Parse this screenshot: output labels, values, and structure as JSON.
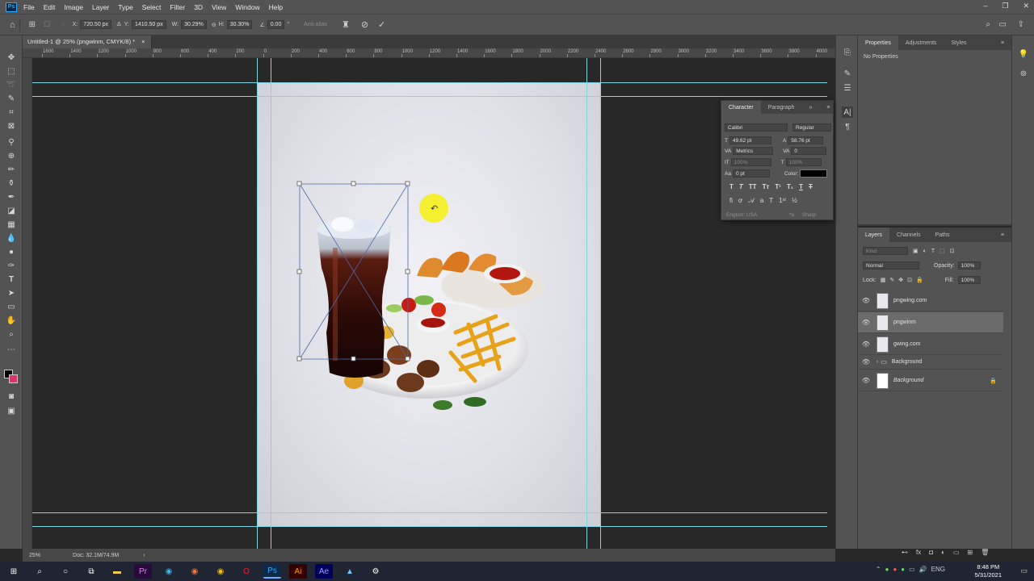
{
  "app": {
    "logo": "Ps"
  },
  "menu": [
    "File",
    "Edit",
    "Image",
    "Layer",
    "Type",
    "Select",
    "Filter",
    "3D",
    "View",
    "Window",
    "Help"
  ],
  "options": {
    "x_label": "X:",
    "x_value": "720.50 px",
    "y_label": "Y:",
    "y_value": "1410.50 px",
    "w_label": "W:",
    "w_value": "30.29%",
    "h_label": "H:",
    "h_value": "30.30%",
    "angle_value": "0.00",
    "angle_unit": "°",
    "antialias": "Anti-alias"
  },
  "doc_tab": {
    "title": "Untitled-1 @ 25% (pngwinm, CMYK/8) *",
    "close": "×"
  },
  "ruler": {
    "h_ticks": [
      "1600",
      "1400",
      "1200",
      "1000",
      "800",
      "600",
      "400",
      "200",
      "0",
      "200",
      "400",
      "600",
      "800",
      "1000",
      "1200",
      "1400",
      "1600",
      "1800",
      "2000",
      "2200",
      "2400",
      "2600",
      "2800",
      "3000",
      "3200",
      "3400",
      "3600",
      "3800",
      "4000",
      "4200"
    ]
  },
  "status": {
    "zoom": "25%",
    "doc": "Doc: 32.1M/74.9M"
  },
  "properties_panel": {
    "tabs": [
      "Properties",
      "Adjustments",
      "Styles"
    ],
    "content": "No Properties"
  },
  "character_panel": {
    "tabs": [
      "Character",
      "Paragraph"
    ],
    "font_family": "Calibri",
    "font_style": "Regular",
    "size": "49.62 pt",
    "leading": "58.76 pt",
    "kerning": "Metrics",
    "tracking": "0",
    "vscale": "100%",
    "hscale": "100%",
    "baseline": "0 pt",
    "color_label": "Color:",
    "language": "English: USA",
    "aa": "Sharp"
  },
  "layers_panel": {
    "tabs": [
      "Layers",
      "Channels",
      "Paths"
    ],
    "search": "Kind",
    "blend": "Normal",
    "opacity_label": "Opacity:",
    "opacity": "100%",
    "lock_label": "Lock:",
    "fill_label": "Fill:",
    "fill": "100%",
    "layers": [
      {
        "name": "pngwing.com",
        "selected": false
      },
      {
        "name": "pngwinm",
        "selected": true
      },
      {
        "name": "gwing.com",
        "selected": false
      },
      {
        "name": "Background",
        "group": true
      },
      {
        "name": "Background",
        "locked": true
      }
    ]
  },
  "taskbar": {
    "time": "8:48 PM",
    "date": "5/31/2021",
    "lang": "ENG"
  },
  "colors": {
    "accent": "#31a8ff",
    "guide": "#7ed5e3",
    "panel": "#535353"
  }
}
